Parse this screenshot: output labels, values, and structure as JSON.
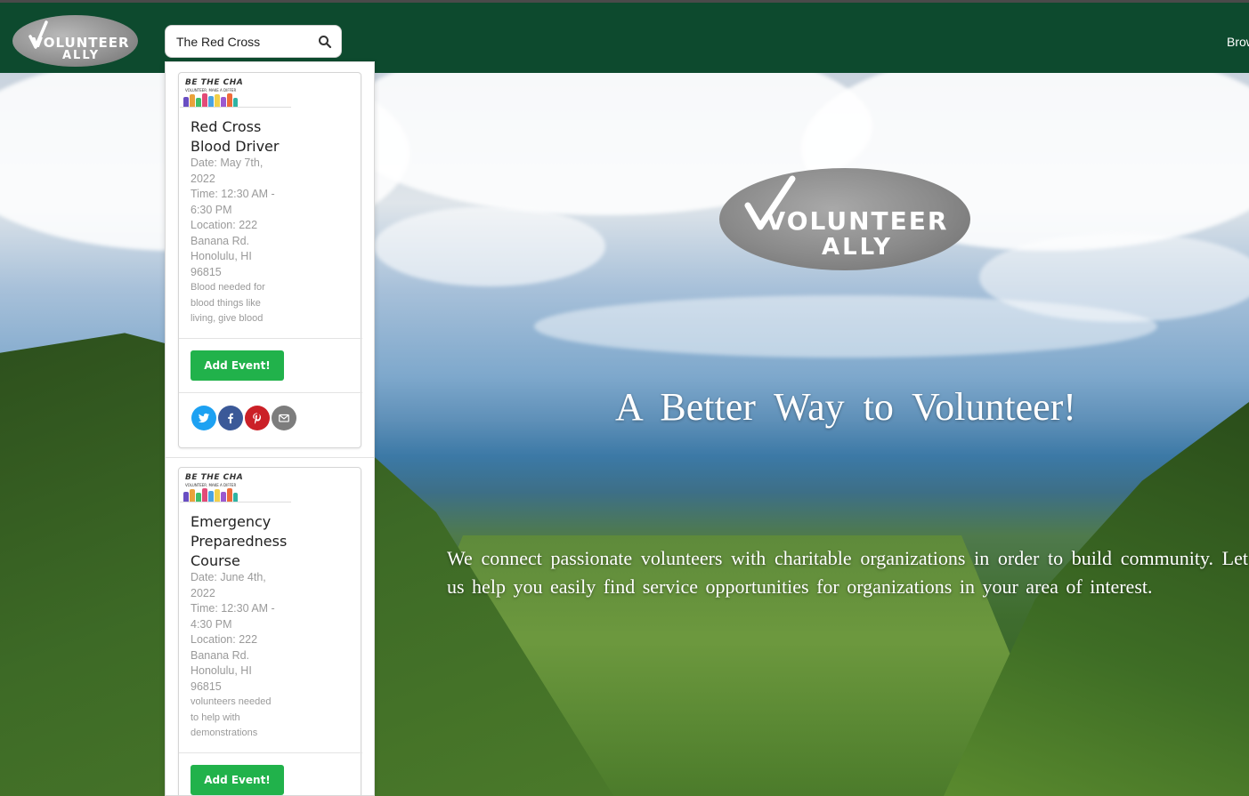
{
  "header": {
    "logo": {
      "line1": "VOLUNTEER",
      "line2": "ALLY"
    },
    "search": {
      "value": "The Red Cross",
      "icon": "search-icon"
    },
    "browse_label": "Brow"
  },
  "hero": {
    "logo": {
      "line1": "VOLUNTEER",
      "line2": "ALLY"
    },
    "tagline": "A Better Way to Volunteer!",
    "description": "We connect passionate volunteers with charitable organizations in order to build community. Let us help you easily find service opportunities for organizations in your area of interest."
  },
  "results": [
    {
      "image_text": "BE THE CHA",
      "image_subtext": "VOLUNTEER. MAKE A DIFFER",
      "title_lines": [
        "Red Cross",
        "Blood Driver"
      ],
      "meta_lines": [
        "Date: May 7th,",
        "2022",
        "Time: 12:30 AM -",
        "6:30 PM",
        "Location: 222",
        "Banana Rd.",
        "Honolulu, HI",
        "96815"
      ],
      "note_lines": [
        "Blood needed for",
        "blood things like",
        "living, give blood"
      ],
      "button_label": "Add Event!",
      "share_icons": [
        "twitter-icon",
        "facebook-icon",
        "pinterest-icon",
        "email-icon"
      ]
    },
    {
      "image_text": "BE THE CHA",
      "image_subtext": "VOLUNTEER. MAKE A DIFFER",
      "title_lines": [
        "Emergency",
        "Preparedness",
        "Course"
      ],
      "meta_lines": [
        "Date: June 4th,",
        "2022",
        "Time: 12:30 AM -",
        "4:30 PM",
        "Location: 222",
        "Banana Rd.",
        "Honolulu, HI",
        "96815"
      ],
      "note_lines": [
        "volunteers needed",
        "to help with",
        "demonstrations"
      ],
      "button_label": "Add Event!"
    }
  ],
  "colors": {
    "nav_bg": "#0d4a2e",
    "add_button": "#21b24b",
    "twitter": "#1da1f2",
    "facebook": "#3b5998",
    "pinterest": "#cb2027",
    "email": "#7d7d7d"
  }
}
